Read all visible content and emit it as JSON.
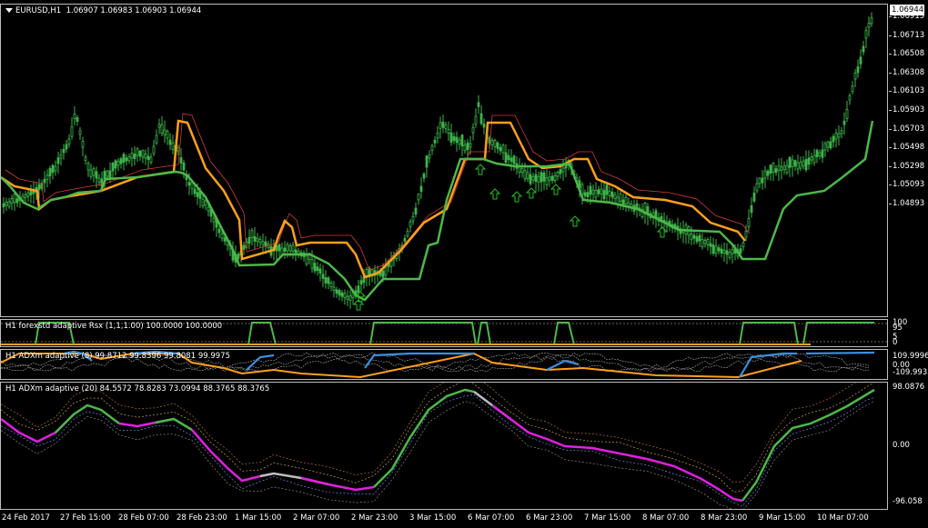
{
  "main": {
    "symbol": "EURUSD,H1",
    "ohlc": "1.06907 1.06983 1.06903 1.06944",
    "current_price": "1.06944",
    "price_labels": [
      "1.06915",
      "1.06713",
      "1.06508",
      "1.06308",
      "1.06103",
      "1.05903",
      "1.05703",
      "1.05498",
      "1.05298",
      "1.05093",
      "1.04893"
    ]
  },
  "rsx": {
    "title": "H1 forexstd adaptive Rsx (1,1,1.00) 100.0000 100.0000",
    "labels": [
      "100",
      "95",
      "5",
      "0"
    ]
  },
  "adx8": {
    "title": "H1 ADXm adaptive (8) 99.8712 99.8396 99.8081 99.9975",
    "labels": [
      "109.9996",
      "0.00",
      "-109.9933"
    ]
  },
  "adx20": {
    "title": "H1 ADXm adaptive (20) 84.5572 78.8283 73.0994 88.3765 88.3765",
    "labels": [
      "98.0876",
      "0.00",
      "-96.058"
    ]
  },
  "time_axis": [
    "24 Feb 2017",
    "27 Feb 15:00",
    "28 Feb 07:00",
    "28 Feb 23:00",
    "1 Mar 15:00",
    "2 Mar 07:00",
    "2 Mar 23:00",
    "3 Mar 15:00",
    "6 Mar 07:00",
    "6 Mar 23:00",
    "7 Mar 15:00",
    "8 Mar 07:00",
    "8 Mar 23:00",
    "9 Mar 15:00",
    "10 Mar 07:00"
  ],
  "colors": {
    "bull_candle": "#3cb44a",
    "orange_line": "#ff9f1a",
    "green_line": "#4cb848",
    "blue_line": "#3b8fe0",
    "magenta_line": "#e020e0",
    "gray_line": "#bdbdbd",
    "signal_arrow": "#22c022"
  }
}
